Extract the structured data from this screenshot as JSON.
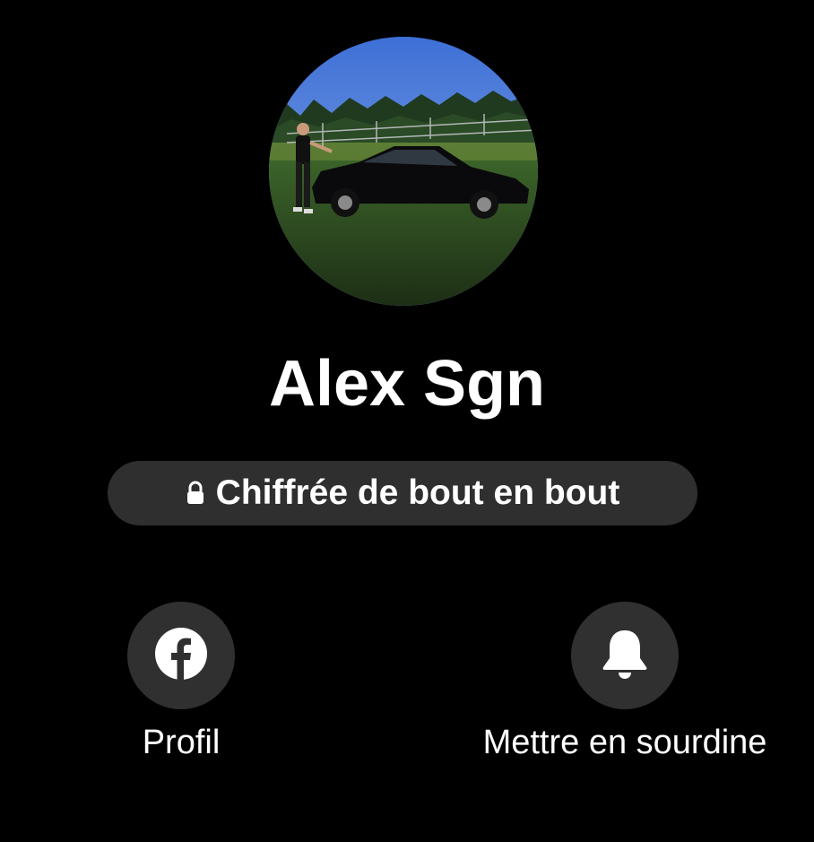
{
  "contact": {
    "name": "Alex Sgn"
  },
  "encryption": {
    "label": "Chiffrée de bout en bout",
    "icon": "lock-icon"
  },
  "actions": [
    {
      "label": "Profil",
      "icon": "facebook-icon"
    },
    {
      "label": "Mettre en sourdine",
      "icon": "bell-icon"
    }
  ],
  "colors": {
    "background": "#000000",
    "surface": "#303030",
    "text": "#ffffff"
  }
}
